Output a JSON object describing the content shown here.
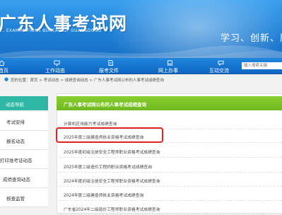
{
  "header": {
    "site_name": "广东人事考试网",
    "site_name_en": "... EXAMINATIONS BUREAU OF GUANGDONG",
    "slogan": "学习、创新、服务、"
  },
  "nav": {
    "items": [
      {
        "label": "首页",
        "icon": "home-icon"
      },
      {
        "label": "工作动态",
        "icon": "monitor-icon"
      },
      {
        "label": "报考文件",
        "icon": "document-icon"
      },
      {
        "label": "网上办事",
        "icon": "computer-icon"
      },
      {
        "label": "互动交流",
        "icon": "chat-icon"
      }
    ],
    "search_placeholder": "输入搜索关键"
  },
  "breadcrumb": {
    "text": "您的位置：首页 > 考试动态 > 成绩查询动态 > 广东人事考试网公布的人事考试成绩查询"
  },
  "sidebar": {
    "title": "动态导航",
    "items": [
      {
        "label": "考试安排"
      },
      {
        "label": "报名动态"
      },
      {
        "label": "打印准考证动态"
      },
      {
        "label": "成绩查询动态"
      },
      {
        "label": "核查监管"
      }
    ]
  },
  "main": {
    "title": "广东人事考试网公布的人事考试成绩查询",
    "rows": [
      {
        "text": "计算机应用能力考试成绩查询"
      },
      {
        "text": "2025年度二级建造师执业资格考试成绩查询"
      },
      {
        "text": "2025年度初级注册安全工程师职业资格考试成绩查询"
      },
      {
        "text": "2025年度二级造价工程师职业资格考试成绩查询"
      },
      {
        "text": "2024年度初级注册安全工程师职业资格考试成绩查询"
      },
      {
        "text": "2024年度二级建造师执业资格考试成绩查询"
      },
      {
        "text": "广东省2024年二级造价工程师职业资格考试成绩查询"
      }
    ]
  }
}
